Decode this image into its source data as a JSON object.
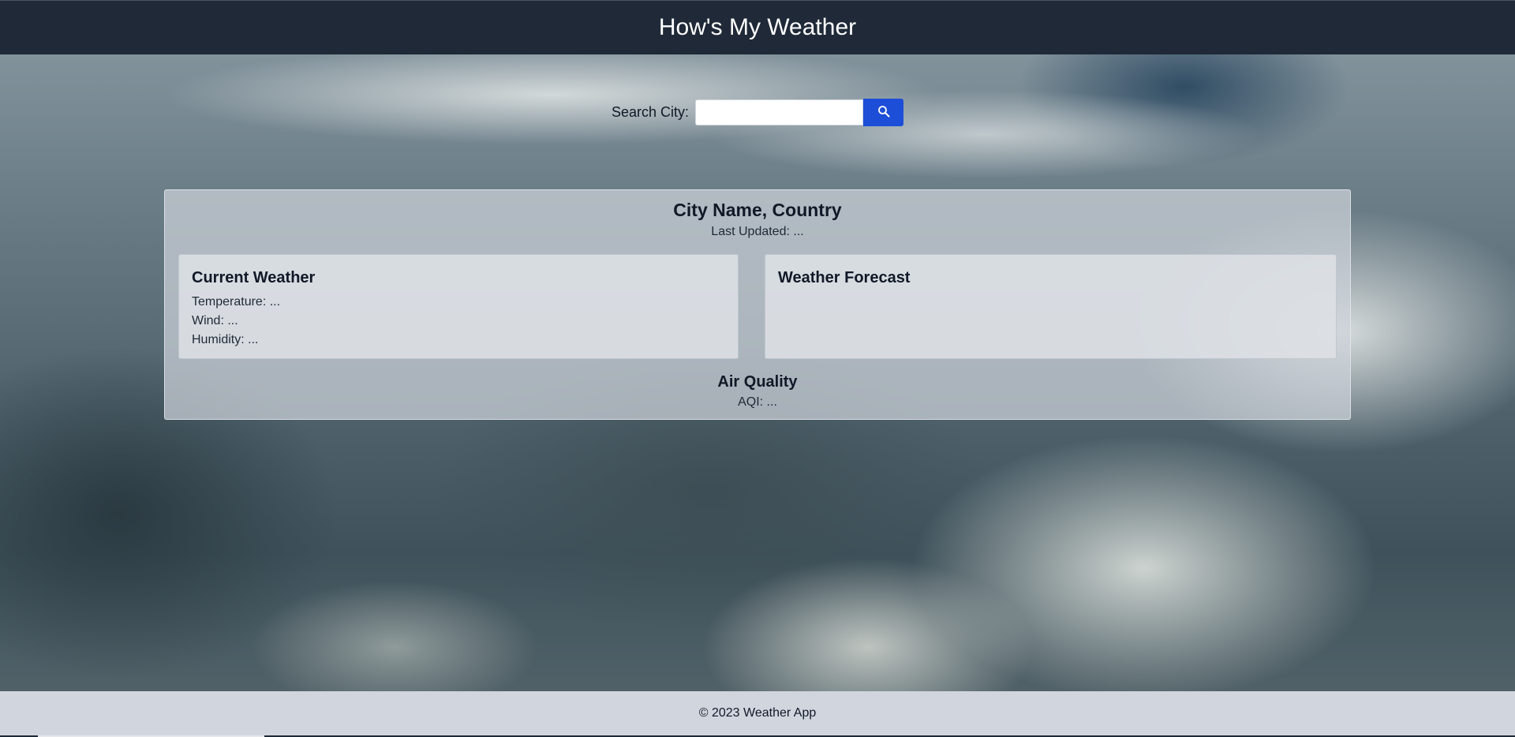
{
  "header": {
    "title": "How's My Weather"
  },
  "search": {
    "label": "Search City:",
    "value": "",
    "placeholder": "",
    "button_icon": "search-icon",
    "button_color": "#1d4ed8"
  },
  "location": {
    "city": "City Name, Country",
    "last_updated": "Last Updated: ..."
  },
  "current_weather": {
    "title": "Current Weather",
    "temperature": "Temperature: ...",
    "wind": "Wind: ...",
    "humidity": "Humidity: ..."
  },
  "forecast": {
    "title": "Weather Forecast"
  },
  "air_quality": {
    "title": "Air Quality",
    "aqi": "AQI: ..."
  },
  "footer": {
    "text": "© 2023 Weather App"
  },
  "colors": {
    "header_bg": "#1f2937",
    "footer_bg": "#d1d5de"
  }
}
